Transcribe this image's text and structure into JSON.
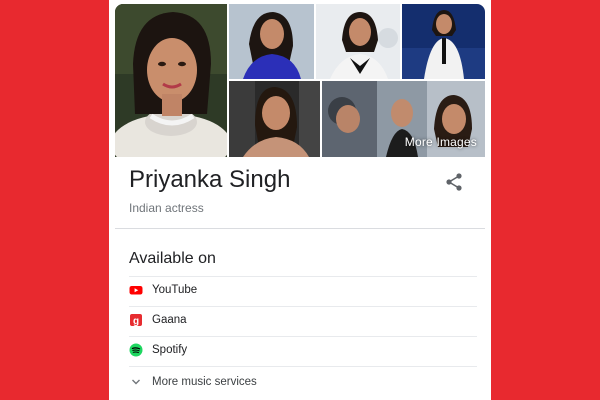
{
  "profile": {
    "name": "Priyanka Singh",
    "description": "Indian actress"
  },
  "gallery": {
    "more_images_label": "More Images"
  },
  "available_on": {
    "heading": "Available on",
    "services": [
      {
        "label": "YouTube",
        "icon": "youtube-icon",
        "color": "#ff0000"
      },
      {
        "label": "Gaana",
        "icon": "gaana-icon",
        "color": "#e72c30"
      },
      {
        "label": "Spotify",
        "icon": "spotify-icon",
        "color": "#1ed760"
      }
    ],
    "more_label": "More music services"
  },
  "colors": {
    "page_background": "#e8292f",
    "card_background": "#ffffff",
    "title_text": "#202124",
    "secondary_text": "#70757a"
  }
}
